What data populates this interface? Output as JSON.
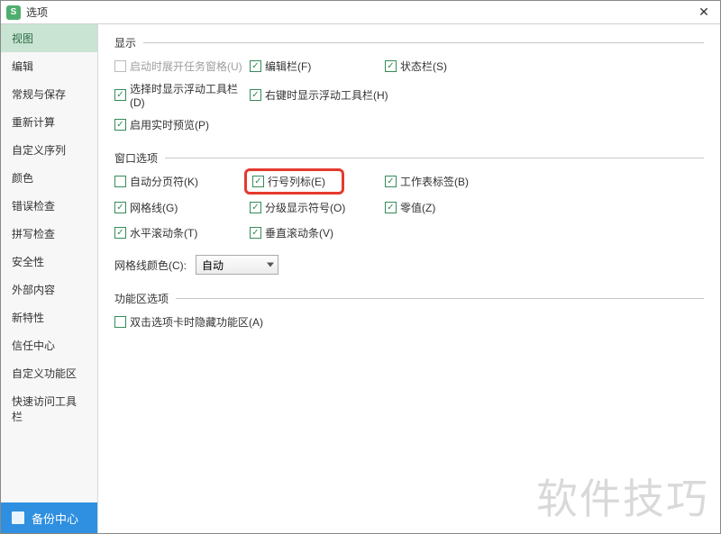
{
  "window": {
    "title": "选项",
    "app_icon_letter": "S",
    "close_symbol": "✕"
  },
  "sidebar": {
    "items": [
      {
        "label": "视图",
        "active": true
      },
      {
        "label": "编辑"
      },
      {
        "label": "常规与保存"
      },
      {
        "label": "重新计算"
      },
      {
        "label": "自定义序列"
      },
      {
        "label": "颜色"
      },
      {
        "label": "错误检查"
      },
      {
        "label": "拼写检查"
      },
      {
        "label": "安全性"
      },
      {
        "label": "外部内容"
      },
      {
        "label": "新特性"
      },
      {
        "label": "信任中心"
      },
      {
        "label": "自定义功能区"
      },
      {
        "label": "快速访问工具栏"
      }
    ],
    "backup_label": "备份中心"
  },
  "sections": {
    "display": {
      "legend": "显示",
      "items": {
        "u": {
          "label": "启动时展开任务窗格(U)",
          "checked": false,
          "disabled": true
        },
        "f": {
          "label": "编辑栏(F)",
          "checked": true
        },
        "s": {
          "label": "状态栏(S)",
          "checked": true
        },
        "d": {
          "label": "选择时显示浮动工具栏(D)",
          "checked": true
        },
        "h": {
          "label": "右键时显示浮动工具栏(H)",
          "checked": true
        },
        "p": {
          "label": "启用实时预览(P)",
          "checked": true
        }
      }
    },
    "winopts": {
      "legend": "窗口选项",
      "items": {
        "k": {
          "label": "自动分页符(K)",
          "checked": false
        },
        "e": {
          "label": "行号列标(E)",
          "checked": true,
          "highlight": true
        },
        "b": {
          "label": "工作表标签(B)",
          "checked": true
        },
        "g": {
          "label": "网格线(G)",
          "checked": true
        },
        "o": {
          "label": "分级显示符号(O)",
          "checked": true
        },
        "z": {
          "label": "零值(Z)",
          "checked": true
        },
        "t": {
          "label": "水平滚动条(T)",
          "checked": true
        },
        "v": {
          "label": "垂直滚动条(V)",
          "checked": true
        }
      },
      "gridcolor_label": "网格线颜色(C):",
      "gridcolor_value": "自动"
    },
    "ribbon": {
      "legend": "功能区选项",
      "items": {
        "a": {
          "label": "双击选项卡时隐藏功能区(A)",
          "checked": false
        }
      }
    }
  },
  "watermark": "软件技巧"
}
